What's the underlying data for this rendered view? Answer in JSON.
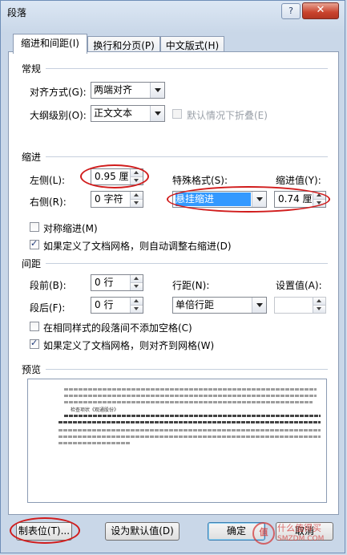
{
  "window": {
    "title": "段落",
    "help_label": "?",
    "close_label": "✕"
  },
  "tabs": [
    {
      "label": "缩进和间距(I)"
    },
    {
      "label": "换行和分页(P)"
    },
    {
      "label": "中文版式(H)"
    }
  ],
  "general": {
    "heading": "常规",
    "alignment_label": "对齐方式(G):",
    "alignment_value": "两端对齐",
    "outline_label": "大纲级别(O):",
    "outline_value": "正文文本",
    "collapse_label": "默认情况下折叠(E)"
  },
  "indent": {
    "heading": "缩进",
    "left_label": "左侧(L):",
    "left_value": "0.95 厘",
    "right_label": "右侧(R):",
    "right_value": "0 字符",
    "special_label": "特殊格式(S):",
    "special_value": "悬挂缩进",
    "by_label": "缩进值(Y):",
    "by_value": "0.74 厘",
    "mirror_label": "对称缩进(M)",
    "auto_adjust_label": "如果定义了文档网格，则自动调整右缩进(D)"
  },
  "spacing": {
    "heading": "间距",
    "before_label": "段前(B):",
    "before_value": "0 行",
    "after_label": "段后(F):",
    "after_value": "0 行",
    "line_label": "行距(N):",
    "line_value": "单倍行距",
    "at_label": "设置值(A):",
    "at_value": "",
    "no_space_label": "在相同样式的段落间不添加空格(C)",
    "snap_grid_label": "如果定义了文档网格，则对齐到网格(W)"
  },
  "preview": {
    "heading": "预览",
    "sample_text": "检查项状《观通股份》"
  },
  "buttons": {
    "tabs": "制表位(T)...",
    "default": "设为默认值(D)",
    "ok": "确定",
    "cancel": "取消"
  },
  "watermark": {
    "logo": "值",
    "text1": "什么值得买",
    "text2": "SMZDM.COM"
  },
  "colors": {
    "highlight": "#3399ff",
    "annotation": "#d11c1c"
  }
}
